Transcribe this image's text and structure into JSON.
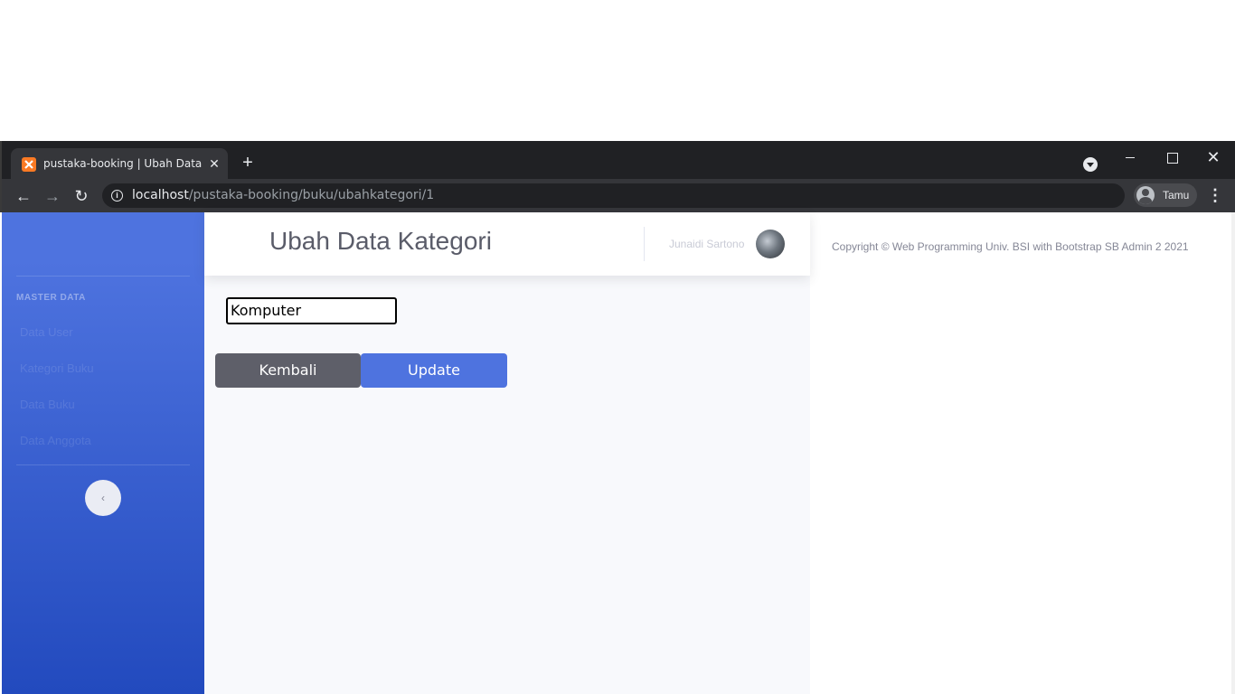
{
  "browser": {
    "tab_title": "pustaka-booking | Ubah Data Kategori",
    "tab_close": "✕",
    "new_tab": "+",
    "url_host": "localhost",
    "url_path": "/pustaka-booking/buku/ubahkategori/1",
    "profile_name": "Tamu",
    "back": "←",
    "forward": "→",
    "reload": "↻",
    "menu": "⋮",
    "close": "✕",
    "info": "i"
  },
  "sidebar": {
    "heading": "MASTER DATA",
    "items": [
      {
        "label": "Data User"
      },
      {
        "label": "Kategori Buku"
      },
      {
        "label": "Data Buku"
      },
      {
        "label": "Data Anggota"
      }
    ],
    "toggle_glyph": "‹"
  },
  "topbar": {
    "title": "Ubah Data Kategori",
    "user_name": "Junaidi Sartono"
  },
  "form": {
    "kategori_value": "Komputer",
    "back_label": "Kembali",
    "update_label": "Update"
  },
  "footer": {
    "copyright": "Copyright © Web Programming Univ. BSI with Bootstrap SB Admin 2 2021"
  }
}
